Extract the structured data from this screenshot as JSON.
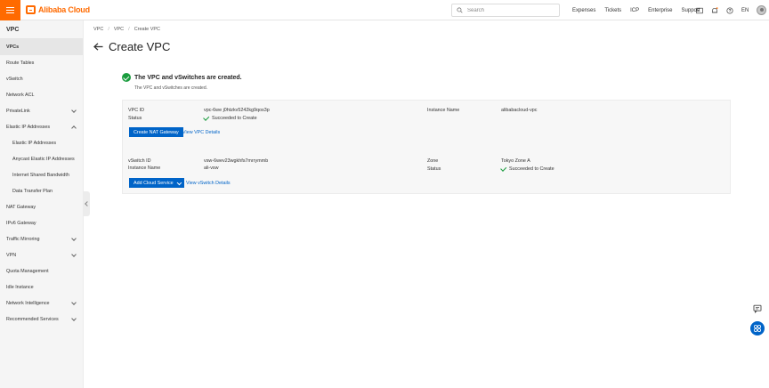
{
  "topbar": {
    "brand": "Alibaba Cloud",
    "search_placeholder": "Search",
    "nav": [
      "Expenses",
      "Tickets",
      "ICP",
      "Enterprise",
      "Support"
    ],
    "lang": "EN"
  },
  "sidebar": {
    "title": "VPC",
    "items": [
      {
        "label": "VPCs"
      },
      {
        "label": "Route Tables"
      },
      {
        "label": "vSwitch"
      },
      {
        "label": "Network ACL"
      },
      {
        "label": "PrivateLink"
      },
      {
        "label": "Elastic IP Addresses"
      },
      {
        "label": "Elastic IP Addresses"
      },
      {
        "label": "Anycast Elastic IP Addresses"
      },
      {
        "label": "Internet Shared Bandwidth"
      },
      {
        "label": "Data Transfer Plan"
      },
      {
        "label": "NAT Gateway"
      },
      {
        "label": "IPv6 Gateway"
      },
      {
        "label": "Traffic Mirroring"
      },
      {
        "label": "VPN"
      },
      {
        "label": "Quota Management"
      },
      {
        "label": "Idle Instance"
      },
      {
        "label": "Network Intelligence"
      },
      {
        "label": "Recommended Services"
      }
    ]
  },
  "breadcrumb": [
    "VPC",
    "VPC",
    "Create VPC"
  ],
  "page_title": "Create VPC",
  "success": {
    "title": "The VPC and vSwitches are created.",
    "subtitle": "The VPC and vSwitches are created."
  },
  "vpc": {
    "id_label": "VPC ID",
    "id_value": "vpc-6we j0htzkv5242kg9qos3p",
    "status_label": "Status",
    "status_value": "Succeeded to Create",
    "instance_name_label": "Instance Name",
    "instance_name_value": "alibabacloud-vpc",
    "create_nat_label": "Create NAT Gateway",
    "view_details_label": "View VPC Details"
  },
  "vswitch": {
    "id_label": "vSwitch ID",
    "id_value": "vsw-6wev23wgkhfs7mrrymmb",
    "instance_name_label": "Instance Name",
    "instance_name_value": "ali-vsw",
    "zone_label": "Zone",
    "zone_value": "Tokyo Zone A",
    "status_label": "Status",
    "status_value": "Succeeded to Create",
    "add_service_label": "Add Cloud Service",
    "view_details_label": "View vSwitch Details"
  },
  "colors": {
    "brand": "#ff6a00",
    "primary": "#0064c8",
    "success": "#1a9c3e"
  }
}
